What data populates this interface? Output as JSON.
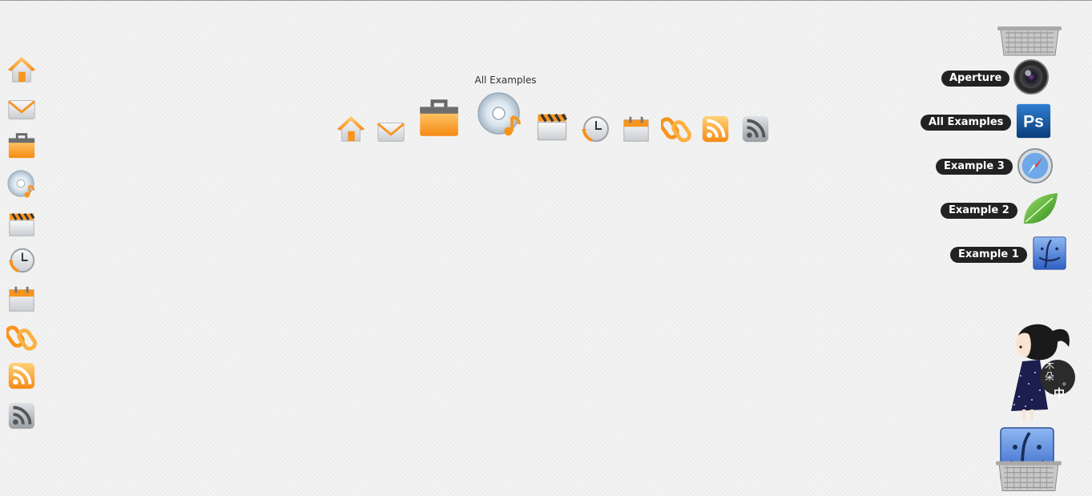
{
  "center_dock": {
    "label": "All Examples",
    "icons": [
      "home-icon",
      "mail-icon",
      "briefcase-icon",
      "music-cd-icon",
      "clapperboard-icon",
      "clock-history-icon",
      "calendar-icon",
      "link-icon",
      "rss-orange-icon",
      "rss-gray-icon"
    ]
  },
  "left_dock": {
    "icons": [
      "home-icon",
      "mail-icon",
      "briefcase-icon",
      "music-cd-icon",
      "clapperboard-icon",
      "clock-history-icon",
      "calendar-icon",
      "link-icon",
      "rss-orange-icon",
      "rss-gray-icon"
    ]
  },
  "stack": {
    "items": [
      {
        "label": "Aperture",
        "icon": "camera-lens-icon"
      },
      {
        "label": "All Examples",
        "icon": "photoshop-icon"
      },
      {
        "label": "Example 3",
        "icon": "safari-compass-icon"
      },
      {
        "label": "Example 2",
        "icon": "leaf-icon"
      },
      {
        "label": "Example 1",
        "icon": "finder-icon"
      }
    ]
  },
  "decoration": {
    "avatar_chars": [
      "木",
      "朵",
      "中",
      "。"
    ]
  },
  "colors": {
    "orange": "#f7941d",
    "pill_bg": "#222222",
    "background": "#f3f3f3"
  }
}
